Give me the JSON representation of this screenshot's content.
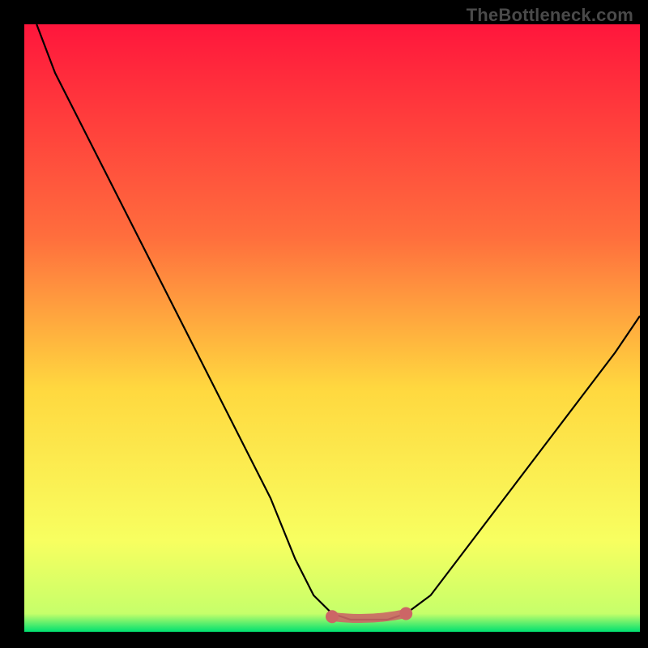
{
  "watermark": "TheBottleneck.com",
  "colors": {
    "background": "#000000",
    "curve": "#000000",
    "marker_stroke": "#CC6666",
    "marker_fill": "#CC6666",
    "grad_top": "#FF163C",
    "grad_mid1": "#FF6E3D",
    "grad_mid2": "#FFD83F",
    "grad_mid3": "#F8FF60",
    "grad_bottom": "#00E070"
  },
  "chart_data": {
    "type": "line",
    "title": "",
    "xlabel": "",
    "ylabel": "",
    "xlim": [
      0,
      100
    ],
    "ylim": [
      0,
      100
    ],
    "series": [
      {
        "name": "bottleneck-curve",
        "x": [
          2,
          5,
          10,
          15,
          20,
          25,
          30,
          35,
          40,
          44,
          47,
          50,
          53,
          56,
          59,
          62,
          66,
          72,
          78,
          84,
          90,
          96,
          100
        ],
        "values": [
          100,
          92,
          82,
          72,
          62,
          52,
          42,
          32,
          22,
          12,
          6,
          3,
          2,
          2,
          2,
          3,
          6,
          14,
          22,
          30,
          38,
          46,
          52
        ]
      }
    ],
    "annotations": [
      {
        "name": "optimal-range-start",
        "x": 50,
        "y": 2.5
      },
      {
        "name": "optimal-range-end",
        "x": 62,
        "y": 3
      }
    ]
  }
}
